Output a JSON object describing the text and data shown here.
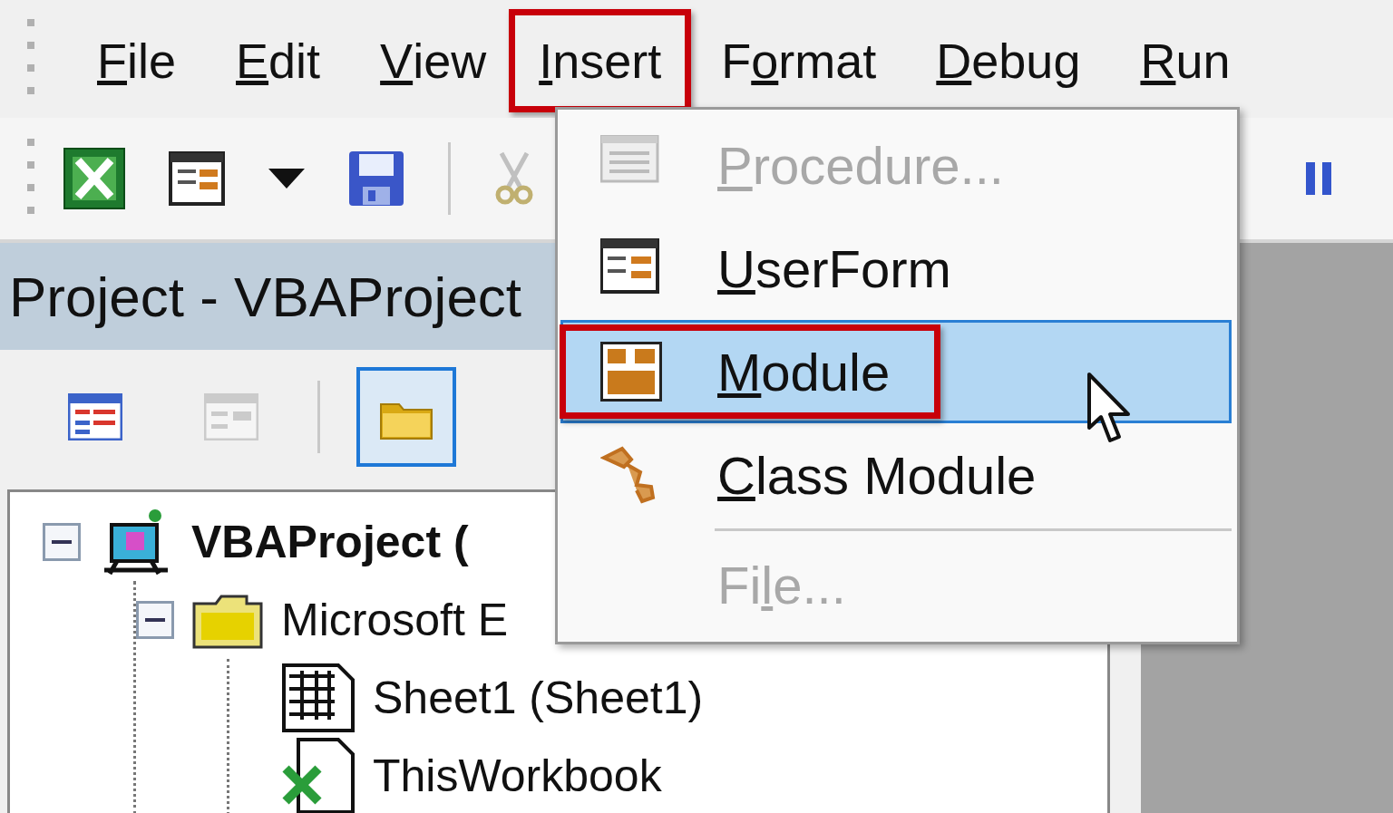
{
  "menu_bar": [
    {
      "key": "F",
      "rest": "ile",
      "highlighted": false
    },
    {
      "key": "E",
      "rest": "dit",
      "highlighted": false
    },
    {
      "key": "V",
      "rest": "iew",
      "highlighted": false
    },
    {
      "key": "I",
      "rest": "nsert",
      "highlighted": true
    },
    {
      "lead": "F",
      "key": "o",
      "rest": "rmat",
      "highlighted": false
    },
    {
      "key": "D",
      "rest": "ebug",
      "highlighted": false
    },
    {
      "key": "R",
      "rest": "un",
      "highlighted": false
    }
  ],
  "insert_menu": [
    {
      "kind": "item",
      "key": "P",
      "rest": "rocedure...",
      "disabled": true,
      "selected": false,
      "highlighted": false
    },
    {
      "kind": "item",
      "key": "U",
      "rest": "serForm",
      "disabled": false,
      "selected": false,
      "highlighted": false
    },
    {
      "kind": "item",
      "key": "M",
      "rest": "odule",
      "disabled": false,
      "selected": true,
      "highlighted": true
    },
    {
      "kind": "item",
      "key": "C",
      "rest": "lass Module",
      "disabled": false,
      "selected": false,
      "highlighted": false
    },
    {
      "kind": "separator"
    },
    {
      "kind": "item",
      "lead": "Fi",
      "key": "l",
      "rest": "e...",
      "disabled": true,
      "selected": false,
      "highlighted": false
    }
  ],
  "project_pane": {
    "title": "Project - VBAProject",
    "view_buttons": [
      {
        "selected": false,
        "disabled": false
      },
      {
        "selected": false,
        "disabled": true
      },
      {
        "selected": true,
        "disabled": false
      }
    ],
    "tree": [
      {
        "label": "VBAProject (",
        "expanded": true,
        "children": [
          {
            "label": "Microsoft E",
            "expanded": true,
            "children": [
              {
                "label": "Sheet1 (Sheet1)"
              },
              {
                "label": "ThisWorkbook"
              }
            ]
          }
        ]
      }
    ]
  }
}
